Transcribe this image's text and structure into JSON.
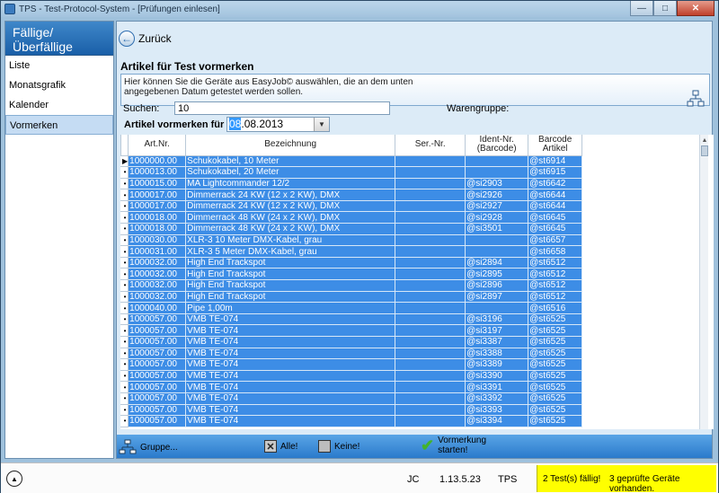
{
  "window": {
    "title": "TPS - Test-Protocol-System - [Prüfungen einlesen]",
    "controls": [
      "—",
      "□",
      "✕"
    ]
  },
  "sidebar": {
    "header": "Fällige/Überfällige Prüfungen",
    "items": [
      {
        "label": "Liste"
      },
      {
        "label": "Monatsgrafik"
      },
      {
        "label": "Kalender"
      },
      {
        "label": "Vormerken"
      }
    ],
    "active_index": 3
  },
  "content": {
    "back_label": "Zurück",
    "section_title": "Artikel für Test vormerken",
    "info_text": "Hier können Sie die Geräte aus EasyJob© auswählen, die an dem unten angegebenen Datum getestet werden sollen.",
    "search_label": "Suchen:",
    "search_value": "10",
    "warengruppe_label": "Warengruppe:",
    "date_label": "Artikel vormerken für den:",
    "date_selected_part": "08",
    "date_rest": ".08.2013"
  },
  "table": {
    "columns": [
      "Art.Nr.",
      "Bezeichnung",
      "Ser.-Nr.",
      "Ident-Nr. (Barcode)",
      "Barcode Artikel"
    ],
    "rows": [
      {
        "marker": "▶",
        "art": "1000000.00",
        "bez": "Schukokabel, 10 Meter",
        "ser": "",
        "ident": "",
        "barcode": "@st6914"
      },
      {
        "marker": "•",
        "art": "1000013.00",
        "bez": "Schukokabel, 20 Meter",
        "ser": "",
        "ident": "",
        "barcode": "@st6915"
      },
      {
        "marker": "•",
        "art": "1000015.00",
        "bez": "MA Lightcommander 12/2",
        "ser": "",
        "ident": "@si2903",
        "barcode": "@st6642"
      },
      {
        "marker": "•",
        "art": "1000017.00",
        "bez": "Dimmerrack 24 KW (12 x 2 KW), DMX",
        "ser": "",
        "ident": "@si2926",
        "barcode": "@st6644"
      },
      {
        "marker": "•",
        "art": "1000017.00",
        "bez": "Dimmerrack 24 KW (12 x 2 KW), DMX",
        "ser": "",
        "ident": "@si2927",
        "barcode": "@st6644"
      },
      {
        "marker": "•",
        "art": "1000018.00",
        "bez": "Dimmerrack 48 KW (24 x 2 KW), DMX",
        "ser": "",
        "ident": "@si2928",
        "barcode": "@st6645"
      },
      {
        "marker": "•",
        "art": "1000018.00",
        "bez": "Dimmerrack 48 KW (24 x 2 KW), DMX",
        "ser": "",
        "ident": "@si3501",
        "barcode": "@st6645"
      },
      {
        "marker": "•",
        "art": "1000030.00",
        "bez": "XLR-3 10 Meter DMX-Kabel, grau",
        "ser": "",
        "ident": "",
        "barcode": "@st6657"
      },
      {
        "marker": "•",
        "art": "1000031.00",
        "bez": "XLR-3 5 Meter DMX-Kabel, grau",
        "ser": "",
        "ident": "",
        "barcode": "@st6658"
      },
      {
        "marker": "•",
        "art": "1000032.00",
        "bez": "High End Trackspot",
        "ser": "",
        "ident": "@si2894",
        "barcode": "@st6512"
      },
      {
        "marker": "•",
        "art": "1000032.00",
        "bez": "High End Trackspot",
        "ser": "",
        "ident": "@si2895",
        "barcode": "@st6512"
      },
      {
        "marker": "•",
        "art": "1000032.00",
        "bez": "High End Trackspot",
        "ser": "",
        "ident": "@si2896",
        "barcode": "@st6512"
      },
      {
        "marker": "•",
        "art": "1000032.00",
        "bez": "High End Trackspot",
        "ser": "",
        "ident": "@si2897",
        "barcode": "@st6512"
      },
      {
        "marker": "•",
        "art": "1000040.00",
        "bez": "Pipe 1,00m",
        "ser": "",
        "ident": "",
        "barcode": "@st6516"
      },
      {
        "marker": "•",
        "art": "1000057.00",
        "bez": "VMB TE-074",
        "ser": "",
        "ident": "@si3196",
        "barcode": "@st6525"
      },
      {
        "marker": "•",
        "art": "1000057.00",
        "bez": "VMB TE-074",
        "ser": "",
        "ident": "@si3197",
        "barcode": "@st6525"
      },
      {
        "marker": "•",
        "art": "1000057.00",
        "bez": "VMB TE-074",
        "ser": "",
        "ident": "@si3387",
        "barcode": "@st6525"
      },
      {
        "marker": "•",
        "art": "1000057.00",
        "bez": "VMB TE-074",
        "ser": "",
        "ident": "@si3388",
        "barcode": "@st6525"
      },
      {
        "marker": "•",
        "art": "1000057.00",
        "bez": "VMB TE-074",
        "ser": "",
        "ident": "@si3389",
        "barcode": "@st6525"
      },
      {
        "marker": "•",
        "art": "1000057.00",
        "bez": "VMB TE-074",
        "ser": "",
        "ident": "@si3390",
        "barcode": "@st6525"
      },
      {
        "marker": "•",
        "art": "1000057.00",
        "bez": "VMB TE-074",
        "ser": "",
        "ident": "@si3391",
        "barcode": "@st6525"
      },
      {
        "marker": "•",
        "art": "1000057.00",
        "bez": "VMB TE-074",
        "ser": "",
        "ident": "@si3392",
        "barcode": "@st6525"
      },
      {
        "marker": "•",
        "art": "1000057.00",
        "bez": "VMB TE-074",
        "ser": "",
        "ident": "@si3393",
        "barcode": "@st6525"
      },
      {
        "marker": "•",
        "art": "1000057.00",
        "bez": "VMB TE-074",
        "ser": "",
        "ident": "@si3394",
        "barcode": "@st6525"
      }
    ]
  },
  "toolbar": {
    "gruppe_label": "Gruppe...",
    "alle_label": "Alle!",
    "keine_label": "Keine!",
    "start_label_1": "Vormerkung",
    "start_label_2": "starten!"
  },
  "status": {
    "user": "JC",
    "version": "1.13.5.23",
    "app": "TPS",
    "due_tests": "2 Test(s) fällig!",
    "checked_devices": "3 geprüfte Geräte vorhanden."
  },
  "colors": {
    "selection": "#3d8de6",
    "header_blue": "#1a5fa8",
    "warning": "#ffff00"
  }
}
